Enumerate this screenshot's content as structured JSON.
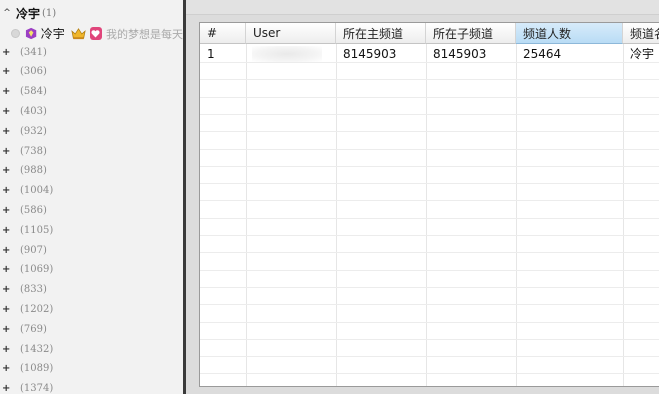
{
  "tree": {
    "root": {
      "toggle": "^",
      "title": "冷宇",
      "count": "(1)"
    },
    "user": {
      "name": "冷宇",
      "motto": "我的梦想是每天"
    },
    "channels": [
      {
        "count": "(341)"
      },
      {
        "count": "(306)"
      },
      {
        "count": "(584)"
      },
      {
        "count": "(403)"
      },
      {
        "count": "(932)"
      },
      {
        "count": "(738)"
      },
      {
        "count": "(988)"
      },
      {
        "count": "(1004)"
      },
      {
        "count": "(586)"
      },
      {
        "count": "(1105)"
      },
      {
        "count": "(907)"
      },
      {
        "count": "(1069)"
      },
      {
        "count": "(833)"
      },
      {
        "count": "(1202)"
      },
      {
        "count": "(769)"
      },
      {
        "count": "(1432)"
      },
      {
        "count": "(1089)"
      },
      {
        "count": "(1374)"
      }
    ]
  },
  "table": {
    "headers": [
      "#",
      "User",
      "所在主频道",
      "所在子频道",
      "频道人数",
      "频道名"
    ],
    "sorted_column": "频道人数",
    "rows": [
      [
        "1",
        "",
        "8145903",
        "8145903",
        "25464",
        "冷宇"
      ]
    ]
  },
  "colors": {
    "sorted_header": "#b9dcf5",
    "divider": "#3a3a3a",
    "motto_badge": "#e0457b"
  }
}
